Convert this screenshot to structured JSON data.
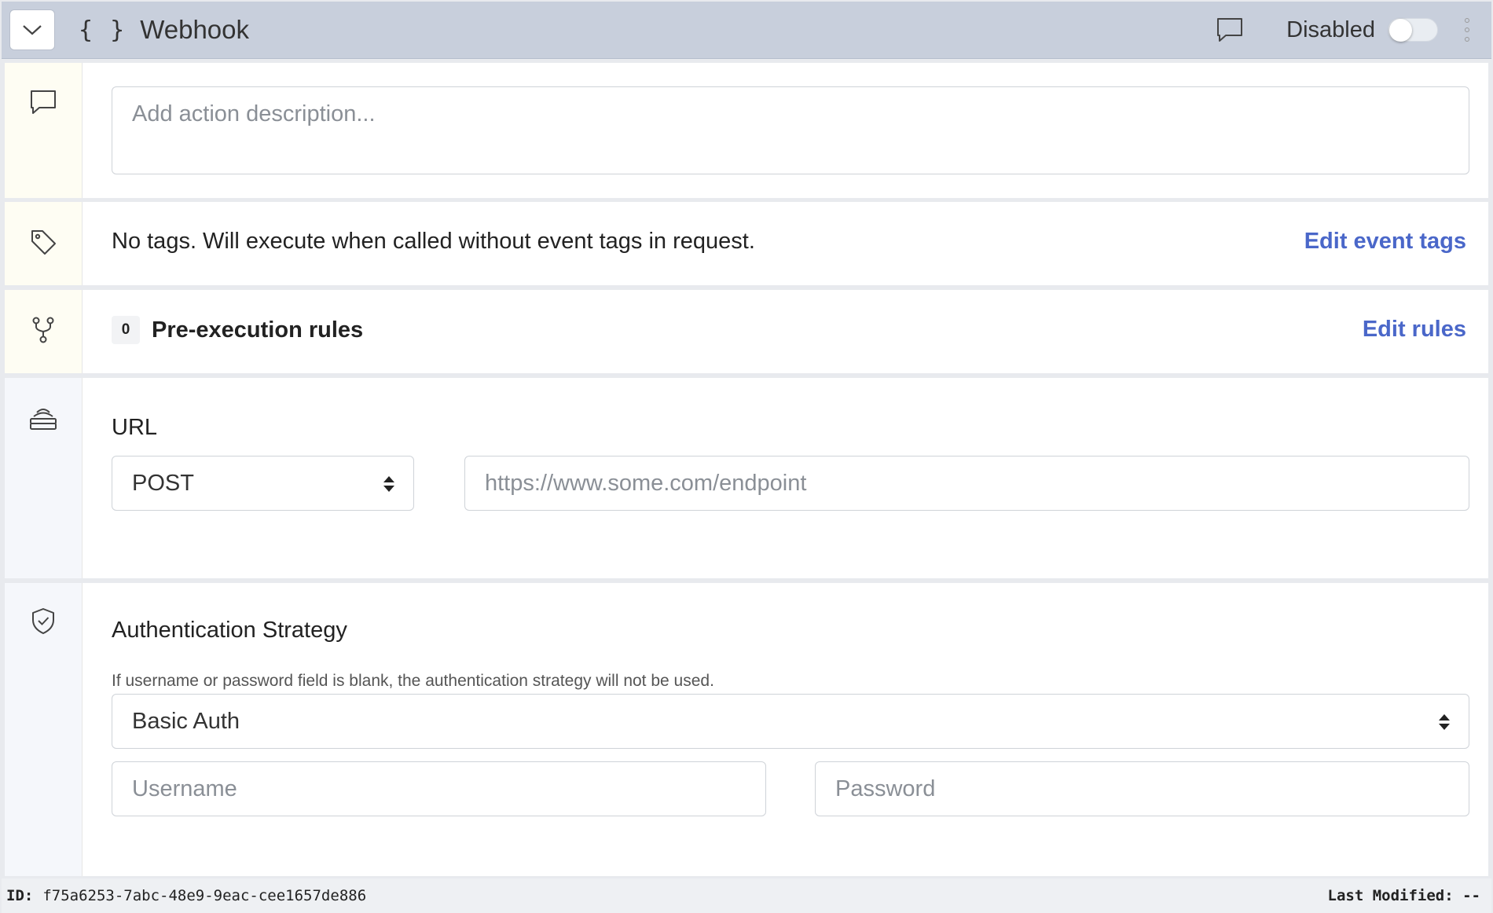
{
  "header": {
    "title": "Webhook",
    "collapse_icon": "chevron-down-icon",
    "type_icon": "curly-braces-icon",
    "type_glyph": "{ }",
    "status_label": "Disabled",
    "enabled": false
  },
  "description": {
    "placeholder": "Add action description...",
    "value": ""
  },
  "tags": {
    "text": "No tags. Will execute when called without event tags in request.",
    "edit_label": "Edit event tags"
  },
  "rules": {
    "count": "0",
    "label": "Pre-execution rules",
    "edit_label": "Edit rules"
  },
  "url": {
    "label": "URL",
    "method": "POST",
    "placeholder": "https://www.some.com/endpoint",
    "value": ""
  },
  "auth": {
    "label": "Authentication Strategy",
    "help": "If username or password field is blank, the authentication strategy will not be used.",
    "strategy": "Basic Auth",
    "username_placeholder": "Username",
    "password_placeholder": "Password"
  },
  "footer": {
    "id_label": "ID:",
    "id_value": "f75a6253-7abc-48e9-9eac-cee1657de886",
    "modified_label": "Last Modified:",
    "modified_value": "--"
  },
  "colors": {
    "header_bg": "#c8cfdc",
    "link": "#4a67c9",
    "gutter_yellow": "#fefdf3",
    "gutter_blue": "#f5f7fb"
  }
}
